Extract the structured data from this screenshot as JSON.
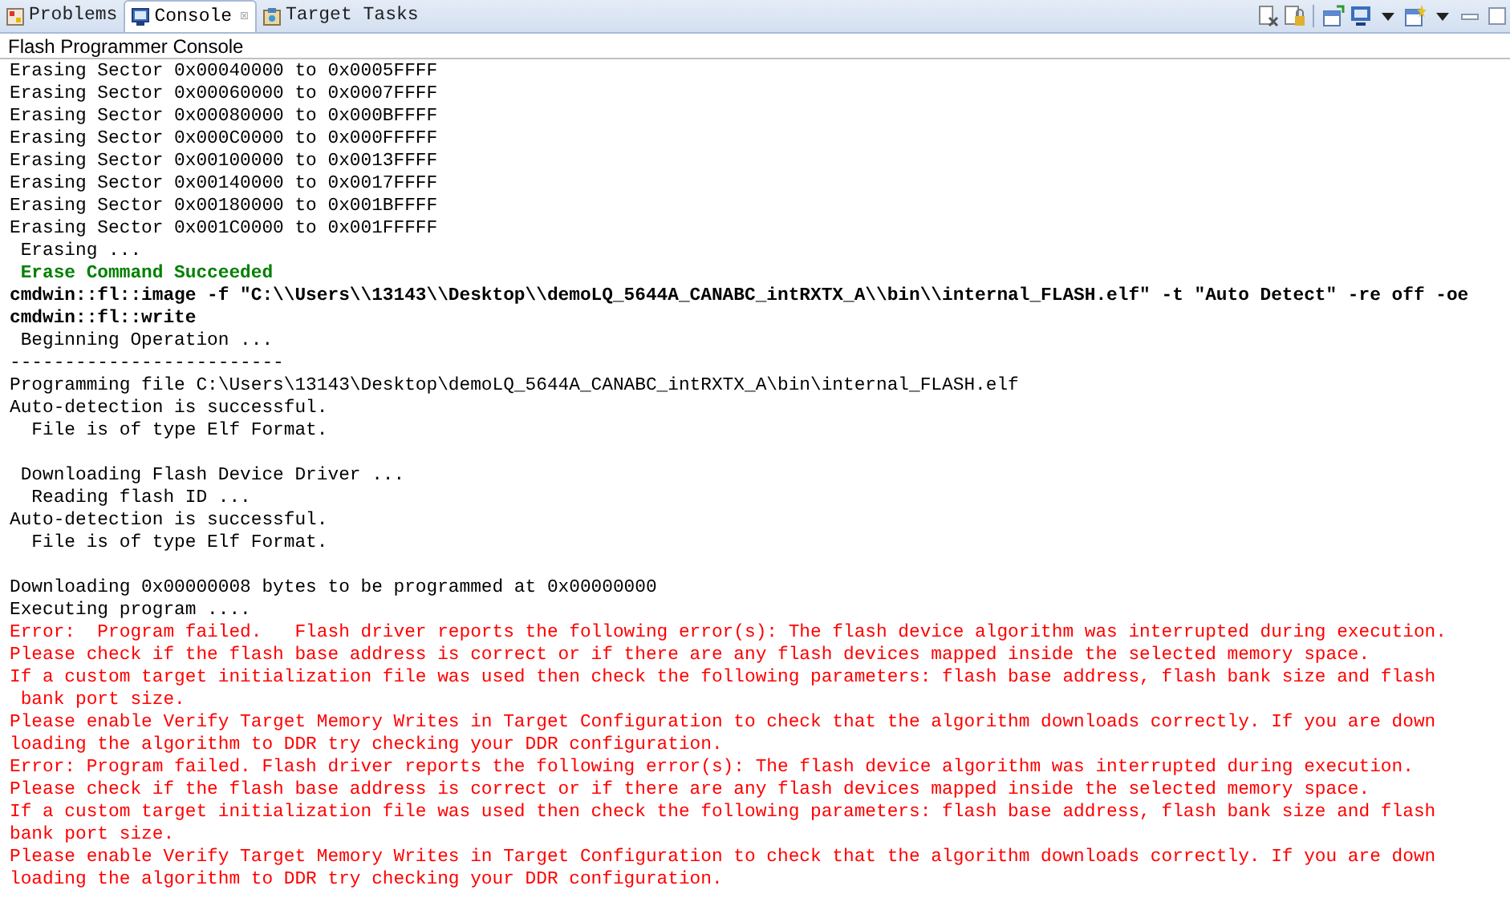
{
  "tabs": [
    {
      "label": "Problems",
      "selected": false
    },
    {
      "label": "Console",
      "selected": true,
      "close": "☒"
    },
    {
      "label": "Target Tasks",
      "selected": false
    }
  ],
  "console": {
    "title": "Flash Programmer Console",
    "lines": [
      {
        "kind": "normal",
        "text": "Erasing Sector 0x00040000 to 0x0005FFFF"
      },
      {
        "kind": "normal",
        "text": "Erasing Sector 0x00060000 to 0x0007FFFF"
      },
      {
        "kind": "normal",
        "text": "Erasing Sector 0x00080000 to 0x000BFFFF"
      },
      {
        "kind": "normal",
        "text": "Erasing Sector 0x000C0000 to 0x000FFFFF"
      },
      {
        "kind": "normal",
        "text": "Erasing Sector 0x00100000 to 0x0013FFFF"
      },
      {
        "kind": "normal",
        "text": "Erasing Sector 0x00140000 to 0x0017FFFF"
      },
      {
        "kind": "normal",
        "text": "Erasing Sector 0x00180000 to 0x001BFFFF"
      },
      {
        "kind": "normal",
        "text": "Erasing Sector 0x001C0000 to 0x001FFFFF"
      },
      {
        "kind": "normal",
        "text": " Erasing ..."
      },
      {
        "kind": "success",
        "text": " Erase Command Succeeded"
      },
      {
        "kind": "command",
        "text": "cmdwin::fl::image -f \"C:\\\\Users\\\\13143\\\\Desktop\\\\demoLQ_5644A_CANABC_intRXTX_A\\\\bin\\\\internal_FLASH.elf\" -t \"Auto Detect\" -re off -oe"
      },
      {
        "kind": "command",
        "text": "cmdwin::fl::write"
      },
      {
        "kind": "normal",
        "text": " Beginning Operation ..."
      },
      {
        "kind": "normal",
        "text": "-------------------------"
      },
      {
        "kind": "normal",
        "text": "Programming file C:\\Users\\13143\\Desktop\\demoLQ_5644A_CANABC_intRXTX_A\\bin\\internal_FLASH.elf"
      },
      {
        "kind": "normal",
        "text": "Auto-detection is successful."
      },
      {
        "kind": "normal",
        "text": "  File is of type Elf Format."
      },
      {
        "kind": "blank"
      },
      {
        "kind": "normal",
        "text": " Downloading Flash Device Driver ..."
      },
      {
        "kind": "normal",
        "text": "  Reading flash ID ..."
      },
      {
        "kind": "normal",
        "text": "Auto-detection is successful."
      },
      {
        "kind": "normal",
        "text": "  File is of type Elf Format."
      },
      {
        "kind": "blank"
      },
      {
        "kind": "normal",
        "text": "Downloading 0x00000008 bytes to be programmed at 0x00000000"
      },
      {
        "kind": "normal",
        "text": "Executing program ...."
      },
      {
        "kind": "error",
        "text": "Error:  Program failed.   Flash driver reports the following error(s): The flash device algorithm was interrupted during execution."
      },
      {
        "kind": "error",
        "text": "Please check if the flash base address is correct or if there are any flash devices mapped inside the selected memory space."
      },
      {
        "kind": "error",
        "text": "If a custom target initialization file was used then check the following parameters: flash base address, flash bank size and flash"
      },
      {
        "kind": "error",
        "text": " bank port size."
      },
      {
        "kind": "error",
        "text": "Please enable Verify Target Memory Writes in Target Configuration to check that the algorithm downloads correctly. If you are down"
      },
      {
        "kind": "error",
        "text": "loading the algorithm to DDR try checking your DDR configuration."
      },
      {
        "kind": "error",
        "text": "Error: Program failed. Flash driver reports the following error(s): The flash device algorithm was interrupted during execution."
      },
      {
        "kind": "error",
        "text": "Please check if the flash base address is correct or if there are any flash devices mapped inside the selected memory space."
      },
      {
        "kind": "error",
        "text": "If a custom target initialization file was used then check the following parameters: flash base address, flash bank size and flash"
      },
      {
        "kind": "error",
        "text": "bank port size."
      },
      {
        "kind": "error",
        "text": "Please enable Verify Target Memory Writes in Target Configuration to check that the algorithm downloads correctly. If you are down"
      },
      {
        "kind": "error",
        "text": "loading the algorithm to DDR try checking your DDR configuration."
      }
    ]
  }
}
